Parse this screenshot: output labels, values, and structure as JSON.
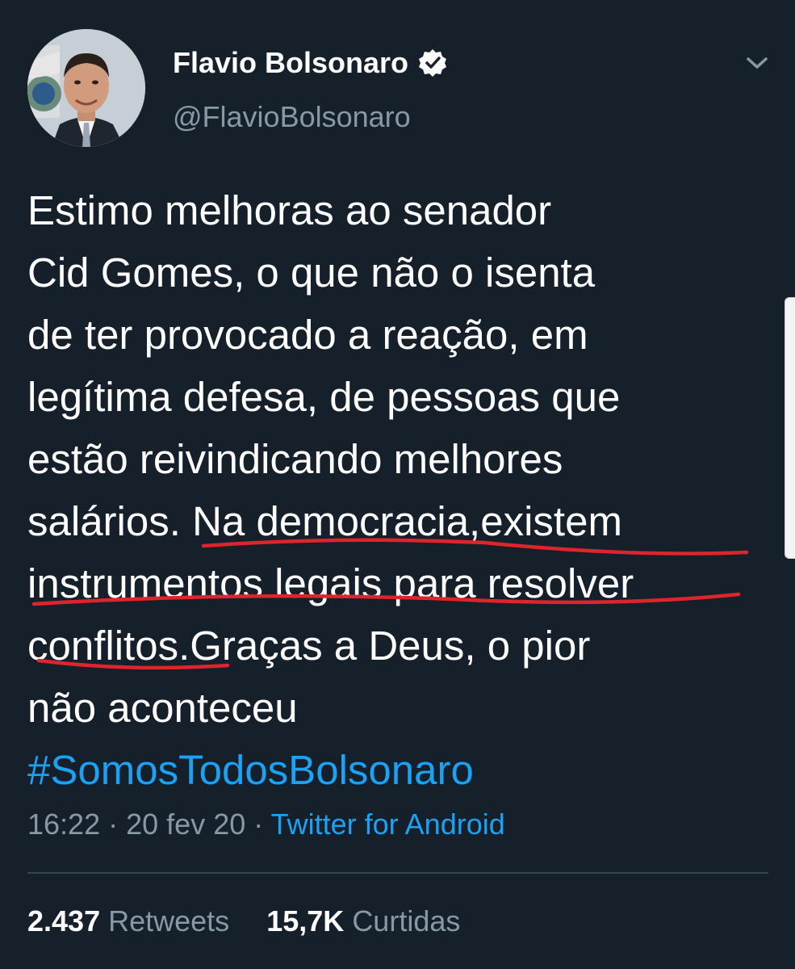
{
  "tweet": {
    "author": {
      "display_name": "Flavio Bolsonaro",
      "handle": "@FlavioBolsonaro",
      "verified": true
    },
    "text_lines": [
      "Estimo melhoras ao senador",
      "Cid Gomes, o que não o isenta",
      "de ter provocado a reação, em",
      "legítima defesa, de pessoas que",
      "estão reivindicando melhores",
      "salários. Na democracia,existem",
      "instrumentos legais para resolver",
      "conflitos.Graças a Deus, o pior",
      "não aconteceu"
    ],
    "hashtag": "#SomosTodosBolsonaro",
    "time": "16:22",
    "separator": "·",
    "date": "20 fev 20",
    "source": "Twitter for Android",
    "stats": {
      "retweets_count": "2.437",
      "retweets_label": "Retweets",
      "likes_count": "15,7K",
      "likes_label": "Curtidas"
    }
  },
  "icons": {
    "verified": "verified-badge-icon",
    "caret": "chevron-down-icon"
  },
  "colors": {
    "background": "#15202b",
    "text": "#ffffff",
    "secondary_text": "#8899a6",
    "link": "#1da1f2",
    "annotation_underline": "#e0242c"
  }
}
